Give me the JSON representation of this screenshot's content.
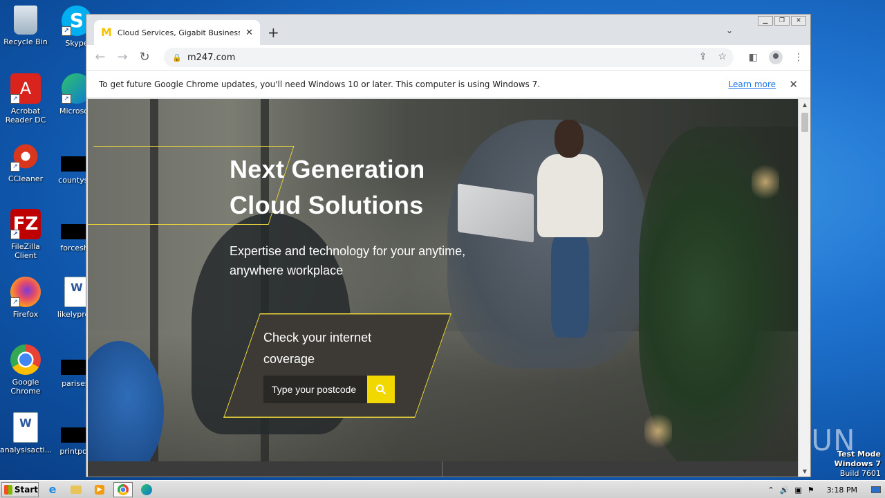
{
  "desktop": {
    "icons": [
      {
        "label": "Recycle Bin",
        "icon": "recycle-bin-icon"
      },
      {
        "label": "Skype",
        "icon": "skype-icon"
      },
      {
        "label": "Acrobat Reader DC",
        "icon": "acrobat-icon"
      },
      {
        "label": "Microsoft",
        "icon": "edge-icon"
      },
      {
        "label": "CCleaner",
        "icon": "ccleaner-icon"
      },
      {
        "label": "countystc",
        "icon": "redacted-icon"
      },
      {
        "label": "FileZilla Client",
        "icon": "filezilla-icon"
      },
      {
        "label": "forceshe",
        "icon": "redacted-icon"
      },
      {
        "label": "Firefox",
        "icon": "firefox-icon"
      },
      {
        "label": "likelyproje",
        "icon": "word-doc-icon"
      },
      {
        "label": "Google Chrome",
        "icon": "chrome-icon"
      },
      {
        "label": "parisest",
        "icon": "redacted-icon"
      },
      {
        "label": "analysisacti...",
        "icon": "word-doc-icon"
      },
      {
        "label": "printpool",
        "icon": "redacted-icon"
      }
    ],
    "os_watermark": {
      "line1": "Test Mode",
      "line2": "Windows 7",
      "line3": "Build 7601"
    },
    "anyrun": "ANY RUN"
  },
  "browser": {
    "tab_title": "Cloud Services, Gigabit Business Inte",
    "tab_favicon": "M",
    "new_tab": "+",
    "url": "m247.com",
    "infobar": {
      "message": "To get future Google Chrome updates, you'll need Windows 10 or later. This computer is using Windows 7.",
      "link": "Learn more"
    }
  },
  "page": {
    "hero_title_line1": "Next Generation",
    "hero_title_line2": "Cloud Solutions",
    "hero_subtitle": "Expertise and technology for your anytime, anywhere workplace",
    "coverage_title": "Check your internet coverage",
    "postcode_placeholder": "Type your postcode",
    "accent": "#f1d800"
  },
  "taskbar": {
    "start_label": "Start",
    "clock": "3:18 PM"
  }
}
